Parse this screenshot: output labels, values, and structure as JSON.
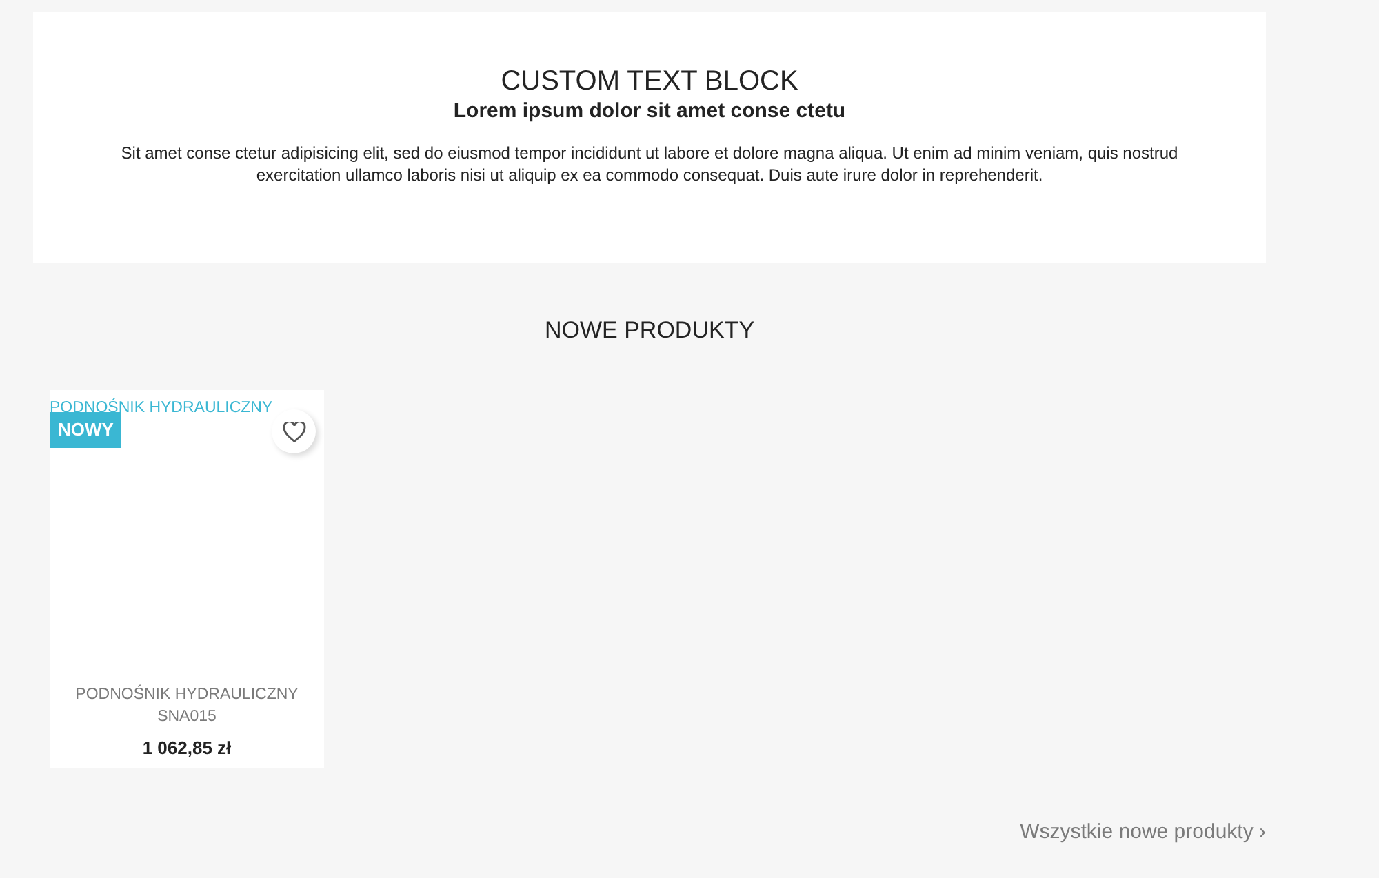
{
  "text_block": {
    "title": "CUSTOM TEXT BLOCK",
    "subtitle": "Lorem ipsum dolor sit amet conse ctetu",
    "body": "Sit amet conse ctetur adipisicing elit, sed do eiusmod tempor incididunt ut labore et dolore magna aliqua. Ut enim ad minim veniam, quis nostrud exercitation ullamco laboris nisi ut aliquip ex ea commodo consequat. Duis aute irure dolor in reprehenderit."
  },
  "section": {
    "title": "NOWE PRODUKTY"
  },
  "products": [
    {
      "image_alt": "PODNOŚNIK HYDRAULICZNY",
      "badge": "NOWY",
      "name": "PODNOŚNIK HYDRAULICZNY SNA015",
      "price": "1 062,85 zł"
    }
  ],
  "all_link": {
    "label": "Wszystkie nowe produkty",
    "arrow": "›"
  }
}
